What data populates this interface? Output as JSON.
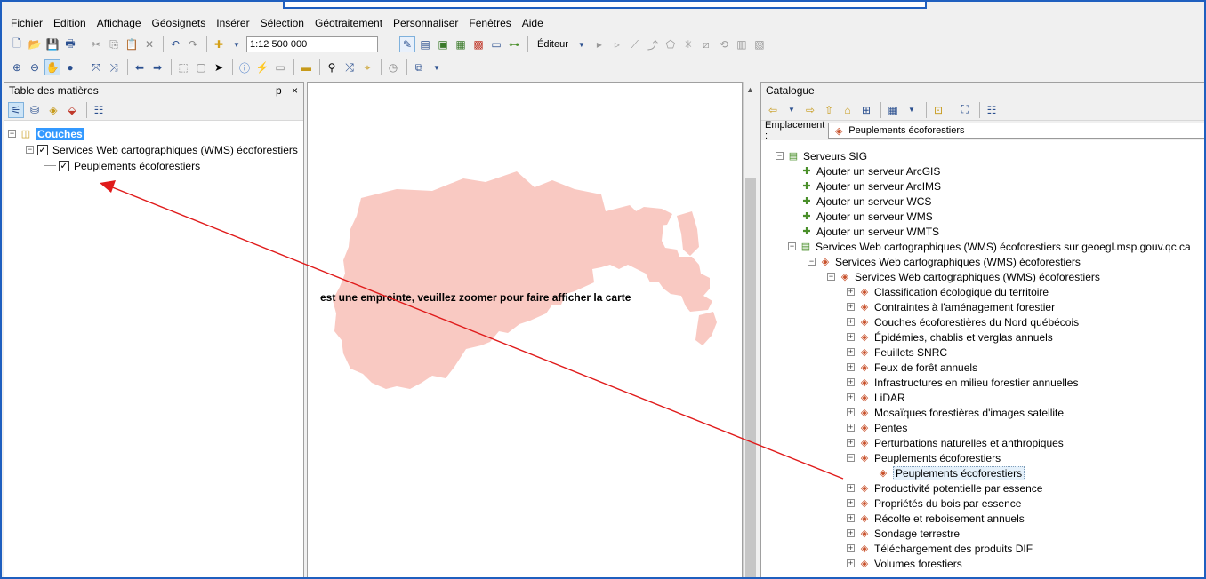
{
  "menu": [
    "Fichier",
    "Edition",
    "Affichage",
    "Géosignets",
    "Insérer",
    "Sélection",
    "Géotraitement",
    "Personnaliser",
    "Fenêtres",
    "Aide"
  ],
  "toolbar": {
    "scale_value": "1:12 500 000",
    "editor_label": "Éditeur"
  },
  "toc": {
    "title": "Table des matières",
    "pin": "ᵽ",
    "close": "×",
    "root_label": "Couches",
    "group_label": "Services Web cartographiques (WMS) écoforestiers",
    "layer_label": "Peuplements écoforestiers"
  },
  "map": {
    "message": "est une empreinte, veuillez zoomer pour faire afficher la carte",
    "footprint_color": "#f9c9c2",
    "arrow_color": "#e01b1b"
  },
  "catalog": {
    "title": "Catalogue",
    "location_label": "Emplacement :",
    "location_value": "Peuplements écoforestiers",
    "servers_label": "Serveurs SIG",
    "add_items": [
      "Ajouter un serveur ArcGIS",
      "Ajouter un serveur ArcIMS",
      "Ajouter un serveur WCS",
      "Ajouter un serveur WMS",
      "Ajouter un serveur WMTS"
    ],
    "wms_server": "Services Web cartographiques (WMS) écoforestiers sur geoegl.msp.gouv.qc.ca",
    "wms_group": "Services Web cartographiques (WMS) écoforestiers",
    "wms_subgroup": "Services Web cartographiques (WMS) écoforestiers",
    "layers": [
      "Classification écologique du territoire",
      "Contraintes à l'aménagement forestier",
      "Couches écoforestières du Nord québécois",
      "Épidémies, chablis et verglas annuels",
      "Feuillets SNRC",
      "Feux de forêt annuels",
      "Infrastructures en milieu forestier annuelles",
      "LiDAR",
      "Mosaïques forestières d'images satellite",
      "Pentes",
      "Perturbations naturelles et anthropiques",
      "Peuplements écoforestiers",
      "Productivité potentielle par essence",
      "Propriétés du bois par essence",
      "Récolte et reboisement annuels",
      "Sondage terrestre",
      "Téléchargement des produits DIF",
      "Volumes forestiers"
    ],
    "selected_child": "Peuplements écoforestiers"
  }
}
